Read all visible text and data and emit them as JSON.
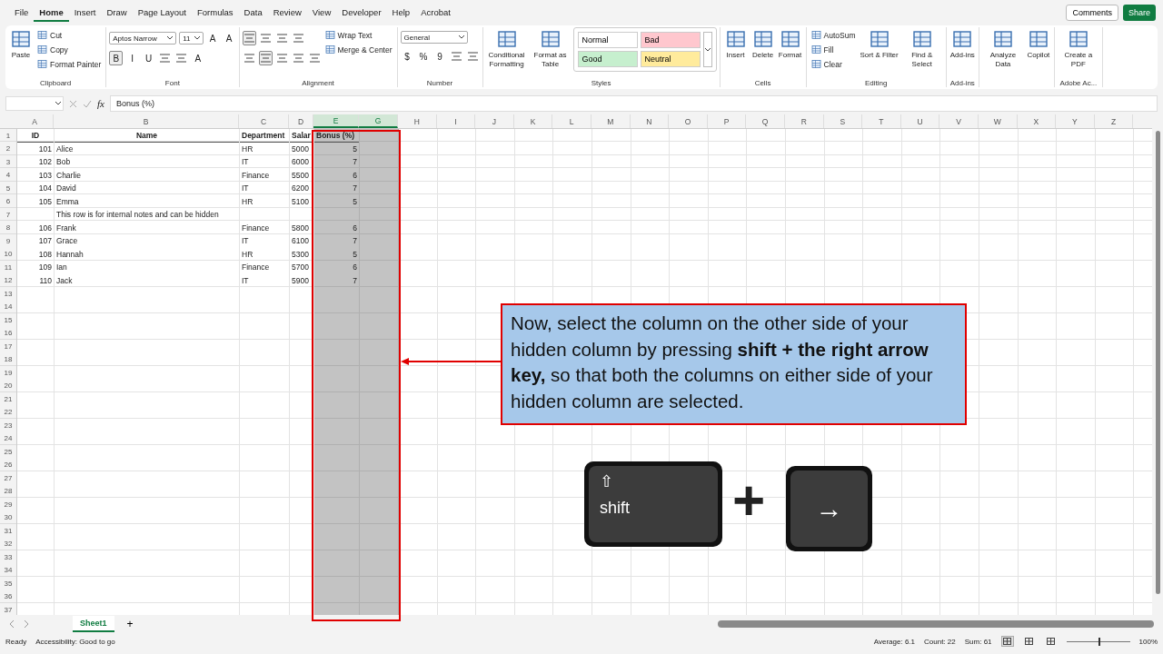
{
  "menu": {
    "tabs": [
      {
        "label": "File",
        "selected": false
      },
      {
        "label": "Home",
        "selected": true
      },
      {
        "label": "Insert",
        "selected": false
      },
      {
        "label": "Draw",
        "selected": false
      },
      {
        "label": "Page Layout",
        "selected": false
      },
      {
        "label": "Formulas",
        "selected": false
      },
      {
        "label": "Data",
        "selected": false
      },
      {
        "label": "Review",
        "selected": false
      },
      {
        "label": "View",
        "selected": false
      },
      {
        "label": "Developer",
        "selected": false
      },
      {
        "label": "Help",
        "selected": false
      },
      {
        "label": "Acrobat",
        "selected": false
      }
    ],
    "comments": "Comments",
    "share": "Share"
  },
  "ribbon": {
    "groups": [
      {
        "label": "Clipboard",
        "blocks": [
          {
            "kind": "large",
            "label": "Paste"
          },
          {
            "kind": "stack",
            "items": [
              {
                "kind": "small",
                "label": "Cut"
              },
              {
                "kind": "small",
                "label": "Copy"
              },
              {
                "kind": "small",
                "label": "Format Painter"
              }
            ]
          }
        ]
      },
      {
        "label": "Font",
        "blocks": [
          {
            "kind": "lines",
            "top": [
              {
                "kind": "field",
                "label": "Aptos Narrow"
              },
              {
                "kind": "field",
                "label": "11"
              },
              {
                "kind": "glyph",
                "label": "A",
                "pressed": false
              },
              {
                "kind": "glyph",
                "label": "A",
                "pressed": false
              }
            ],
            "bottom": [
              {
                "kind": "glyph",
                "label": "B",
                "pressed": true
              },
              {
                "kind": "glyph",
                "label": "I",
                "pressed": false
              },
              {
                "kind": "glyph",
                "label": "U",
                "pressed": false
              },
              {
                "kind": "tool",
                "pressed": false
              },
              {
                "kind": "tool",
                "pressed": false
              },
              {
                "kind": "glyph",
                "label": "A",
                "pressed": false
              }
            ]
          }
        ]
      },
      {
        "label": "Alignment",
        "blocks": [
          {
            "kind": "lines",
            "top": [
              {
                "kind": "tool",
                "pressed": true
              },
              {
                "kind": "tool",
                "pressed": false
              },
              {
                "kind": "tool",
                "pressed": false
              },
              {
                "kind": "tool",
                "pressed": false
              }
            ],
            "bottom": [
              {
                "kind": "tool",
                "pressed": false
              },
              {
                "kind": "tool",
                "pressed": true
              },
              {
                "kind": "tool",
                "pressed": false
              },
              {
                "kind": "tool",
                "pressed": false
              },
              {
                "kind": "tool",
                "pressed": false
              }
            ]
          },
          {
            "kind": "stack",
            "items": [
              {
                "kind": "small",
                "label": "Wrap Text"
              },
              {
                "kind": "small",
                "label": "Merge & Center"
              }
            ]
          }
        ]
      },
      {
        "label": "Number",
        "blocks": [
          {
            "kind": "lines",
            "top": [
              {
                "kind": "field",
                "label": "General"
              }
            ],
            "bottom": [
              {
                "kind": "glyph",
                "label": "$",
                "pressed": false
              },
              {
                "kind": "glyph",
                "label": "%",
                "pressed": false
              },
              {
                "kind": "glyph",
                "label": "9",
                "pressed": false
              },
              {
                "kind": "tool",
                "pressed": false
              },
              {
                "kind": "tool",
                "pressed": false
              }
            ]
          }
        ]
      },
      {
        "label": "Styles",
        "blocks": [
          {
            "kind": "large",
            "label": "Conditional Formatting"
          },
          {
            "kind": "large",
            "label": "Format as Table"
          },
          {
            "kind": "styles",
            "items": [
              {
                "label": "Normal",
                "color": "#ffffff"
              },
              {
                "label": "Bad",
                "color": "#ffc7ce"
              },
              {
                "label": "Good",
                "color": "#c6efce"
              },
              {
                "label": "Neutral",
                "color": "#ffeb9c"
              }
            ]
          }
        ]
      },
      {
        "label": "Cells",
        "blocks": [
          {
            "kind": "large",
            "label": "Insert"
          },
          {
            "kind": "large",
            "label": "Delete"
          },
          {
            "kind": "large",
            "label": "Format"
          }
        ]
      },
      {
        "label": "Editing",
        "blocks": [
          {
            "kind": "stack",
            "items": [
              {
                "kind": "small",
                "label": "AutoSum"
              },
              {
                "kind": "small",
                "label": "Fill"
              },
              {
                "kind": "small",
                "label": "Clear"
              }
            ]
          },
          {
            "kind": "large",
            "label": "Sort & Filter"
          },
          {
            "kind": "large",
            "label": "Find & Select"
          }
        ]
      },
      {
        "label": "Add-ins",
        "blocks": [
          {
            "kind": "large",
            "label": "Add-ins"
          }
        ]
      },
      {
        "blocks": [
          {
            "kind": "large",
            "label": "Analyze Data"
          },
          {
            "kind": "large",
            "label": "Copilot"
          }
        ]
      },
      {
        "label": "Adobe Ac...",
        "blocks": [
          {
            "kind": "large",
            "label": "Create a PDF"
          }
        ]
      }
    ]
  },
  "formula_bar": {
    "fx": "fx",
    "formula": "Bonus (%)"
  },
  "sheet": {
    "columns": [
      {
        "letter": "A",
        "selected": false
      },
      {
        "letter": "B",
        "selected": false
      },
      {
        "letter": "C",
        "selected": false
      },
      {
        "letter": "D",
        "selected": false
      },
      {
        "letter": "E",
        "selected": true
      },
      {
        "letter": "G",
        "selected": true
      },
      {
        "letter": "H",
        "selected": false
      },
      {
        "letter": "I",
        "selected": false
      },
      {
        "letter": "J",
        "selected": false
      },
      {
        "letter": "K",
        "selected": false
      },
      {
        "letter": "L",
        "selected": false
      },
      {
        "letter": "M",
        "selected": false
      },
      {
        "letter": "N",
        "selected": false
      },
      {
        "letter": "O",
        "selected": false
      },
      {
        "letter": "P",
        "selected": false
      },
      {
        "letter": "Q",
        "selected": false
      },
      {
        "letter": "R",
        "selected": false
      },
      {
        "letter": "S",
        "selected": false
      },
      {
        "letter": "T",
        "selected": false
      },
      {
        "letter": "U",
        "selected": false
      },
      {
        "letter": "V",
        "selected": false
      },
      {
        "letter": "W",
        "selected": false
      },
      {
        "letter": "X",
        "selected": false
      },
      {
        "letter": "Y",
        "selected": false
      },
      {
        "letter": "Z",
        "selected": false
      }
    ],
    "row_numbers": [
      "1",
      "2",
      "3",
      "4",
      "5",
      "6",
      "7",
      "8",
      "9",
      "10",
      "11",
      "12",
      "13",
      "14",
      "15",
      "16",
      "17",
      "18",
      "19",
      "20",
      "21",
      "22",
      "23",
      "24",
      "25",
      "26",
      "27",
      "28",
      "29",
      "30",
      "31",
      "32",
      "33",
      "34",
      "35",
      "36",
      "37"
    ],
    "header": {
      "A": "ID",
      "B": "Name",
      "C": "Department",
      "D": "Salar",
      "E": "Bonus (%)"
    },
    "rows": [
      {
        "A": "101",
        "B": "Alice",
        "C": "HR",
        "D": "5000",
        "E": "5"
      },
      {
        "A": "102",
        "B": "Bob",
        "C": "IT",
        "D": "6000",
        "E": "7"
      },
      {
        "A": "103",
        "B": "Charlie",
        "C": "Finance",
        "D": "5500",
        "E": "6"
      },
      {
        "A": "104",
        "B": "David",
        "C": "IT",
        "D": "6200",
        "E": "7"
      },
      {
        "A": "105",
        "B": "Emma",
        "C": "HR",
        "D": "5100",
        "E": "5"
      },
      {
        "B": "This row is for internal notes and can be hidden"
      },
      {
        "A": "106",
        "B": "Frank",
        "C": "Finance",
        "D": "5800",
        "E": "6"
      },
      {
        "A": "107",
        "B": "Grace",
        "C": "IT",
        "D": "6100",
        "E": "7"
      },
      {
        "A": "108",
        "B": "Hannah",
        "C": "HR",
        "D": "5300",
        "E": "5"
      },
      {
        "A": "109",
        "B": "Ian",
        "C": "Finance",
        "D": "5700",
        "E": "6"
      },
      {
        "A": "110",
        "B": "Jack",
        "C": "IT",
        "D": "5900",
        "E": "7"
      }
    ]
  },
  "callout": {
    "text": "Now, select the column on the other side of your hidden column by pressing **shift + the right arrow key,** so that both the columns on either side of your hidden column are selected."
  },
  "keys": {
    "items": [
      {
        "kind": "modifier",
        "glyph": "⇧",
        "label": "shift"
      },
      {
        "kind": "arrow",
        "glyph": "→"
      }
    ],
    "joiner": "+"
  },
  "sheet_tabs": {
    "tabs": [
      {
        "label": "Sheet1",
        "selected": true
      }
    ],
    "add": "+"
  },
  "status": {
    "ready": "Ready",
    "accessibility": "Accessibility: Good to go",
    "stats": [
      "Average: 6.1",
      "Count: 22",
      "Sum: 61"
    ],
    "views": [
      {
        "selected": true
      },
      {
        "selected": false
      },
      {
        "selected": false
      }
    ],
    "zoom_slider": {
      "level": 0.5
    },
    "zoom": "100%"
  }
}
